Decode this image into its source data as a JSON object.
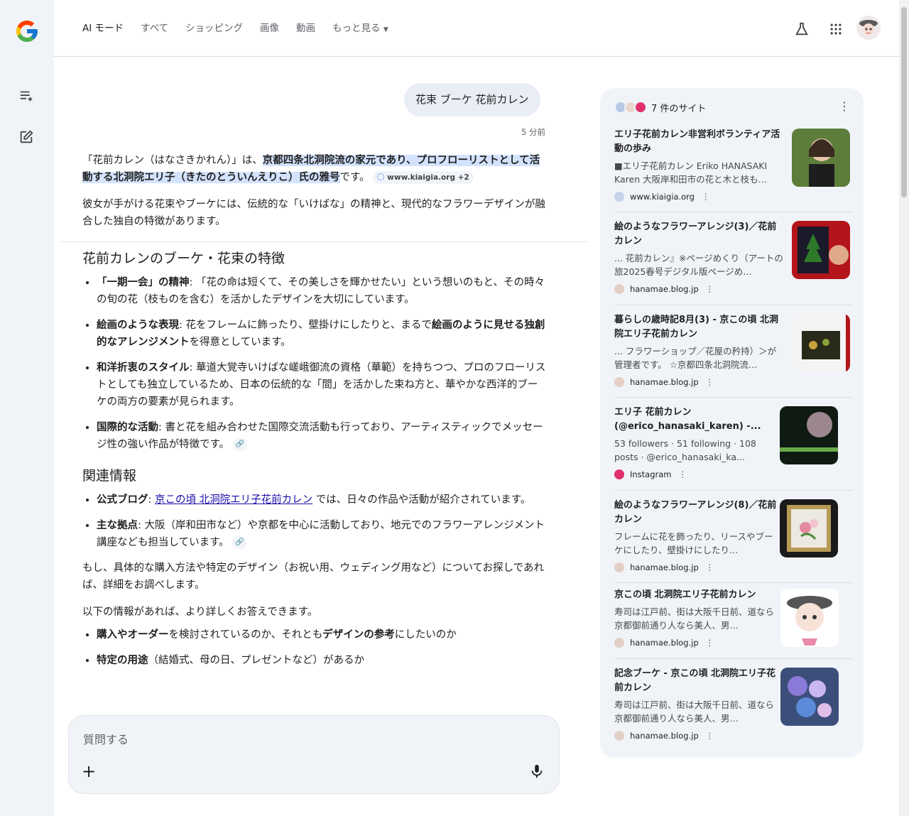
{
  "nav": {
    "tabs": [
      {
        "label": "AI モード"
      },
      {
        "label": "すべて"
      },
      {
        "label": "ショッピング"
      },
      {
        "label": "画像"
      },
      {
        "label": "動画"
      },
      {
        "label": "もっと見る"
      }
    ]
  },
  "query": {
    "text": "花束 ブーケ 花前カレン",
    "time": "5 分前"
  },
  "answer": {
    "intro_pre": "「花前カレン（はなさきかれん）」は、",
    "intro_hl": "京都四条北洞院流の家元であり、プロフローリストとして活動する北洞院エリ子（きたのとういんえりこ）氏の雅号",
    "intro_post": "です。",
    "intro_chip": "www.kiaigia.org +2",
    "para2": "彼女が手がける花束やブーケには、伝統的な「いけばな」の精神と、現代的なフラワーデザインが融合した独自の特徴があります。",
    "h_features": "花前カレンのブーケ・花束の特徴",
    "f1_b": "「一期一会」の精神",
    "f1_t": ": 「花の命は短くて、その美しさを輝かせたい」という想いのもと、その時々の旬の花（枝ものを含む）を活かしたデザインを大切にしています。",
    "f2_b": "絵画のような表現",
    "f2_t1": ": 花をフレームに飾ったり、壁掛けにしたりと、まるで",
    "f2_b2": "絵画のように見せる独創的なアレンジメント",
    "f2_t2": "を得意としています。",
    "f3_b": "和洋折衷のスタイル",
    "f3_t": ": 華道大覚寺いけばな嵯峨御流の資格（華範）を持ちつつ、プロのフローリストとしても独立しているため、日本の伝統的な「間」を活かした束ね方と、華やかな西洋的ブーケの両方の要素が見られます。",
    "f4_b": "国際的な活動",
    "f4_t": ": 書と花を組み合わせた国際交流活動も行っており、アーティスティックでメッセージ性の強い作品が特徴です。",
    "h_related": "関連情報",
    "r1_b": "公式ブログ",
    "r1_link": "京この頃 北洞院エリ子花前カレン",
    "r1_t": " では、日々の作品や活動が紹介されています。",
    "r2_b": "主な拠点",
    "r2_t": ": 大阪（岸和田市など）や京都を中心に活動しており、地元でのフラワーアレンジメント講座なども担当しています。",
    "para3": "もし、具体的な購入方法や特定のデザイン（お祝い用、ウェディング用など）についてお探しであれば、詳細をお調べします。",
    "para4": "以下の情報があれば、より詳しくお答えできます。",
    "q1_b1": "購入やオーダー",
    "q1_t1": "を検討されているのか、それとも",
    "q1_b2": "デザインの参考",
    "q1_t2": "にしたいのか",
    "q2_b": "特定の用途",
    "q2_t": "（結婚式、母の日、プレゼントなど）があるか"
  },
  "ask": {
    "placeholder": "質問する"
  },
  "sources": {
    "count_label": "7 件のサイト",
    "items": [
      {
        "title": "エリ子花前カレン非営利ボランティア活動の歩み",
        "snippet": "■エリ子花前カレン Eriko HANASAKI Karen 大阪岸和田市の花と木と枝も…",
        "site": "www.kiaigia.org"
      },
      {
        "title": "絵のようなフラワーアレンジ(3)／花前カレン",
        "snippet": "... 花前カレン』※ページめくり（アートの旅2025春号デジタル版ページめ…",
        "site": "hanamae.blog.jp"
      },
      {
        "title": "暮らしの歳時記8月(3) - 京この頃 北洞院エリ子花前カレン",
        "snippet": "... フラワーショップ／花屋の矜持）＞が管理者です。 ☆京都四条北洞院流…",
        "site": "hanamae.blog.jp"
      },
      {
        "title": "エリ子 花前カレン (@erico_hanasaki_karen) -...",
        "snippet": "53 followers · 51 following · 108 posts · @erico_hanasaki_ka...",
        "site": "Instagram"
      },
      {
        "title": "絵のようなフラワーアレンジ(8)／花前カレン",
        "snippet": "フレームに花を飾ったり、リースやブーケにしたり、壁掛けにしたり…",
        "site": "hanamae.blog.jp"
      },
      {
        "title": "京この頃 北洞院エリ子花前カレン",
        "snippet": "寿司は江戸前、街は大阪千日前、道なら京都御前通り人なら美人、男…",
        "site": "hanamae.blog.jp"
      },
      {
        "title": "記念ブーケ - 京この頃 北洞院エリ子花前カレン",
        "snippet": "寿司は江戸前、街は大阪千日前、道なら京都御前通り人なら美人、男…",
        "site": "hanamae.blog.jp"
      }
    ]
  },
  "colors": {
    "accent": "#1a73e8",
    "highlight": "#d3e3fd",
    "panel_bg": "#f0f4f9",
    "link": "#1a0dab"
  }
}
